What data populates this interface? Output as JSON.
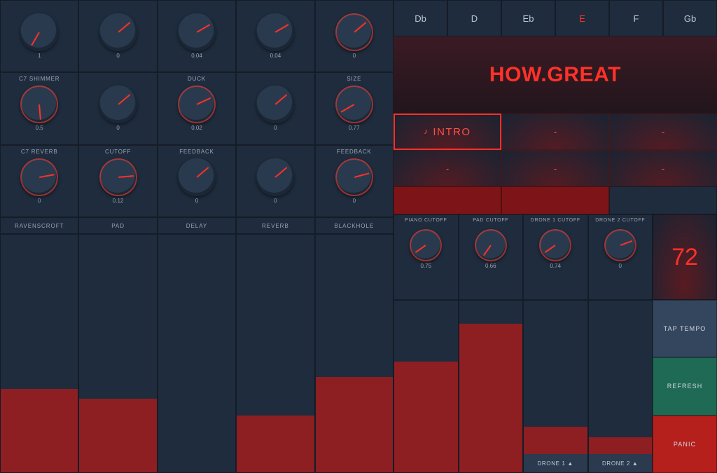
{
  "knobs": {
    "row0": [
      {
        "label": "",
        "value": "1",
        "angle": 30,
        "hot": 0
      },
      {
        "label": "",
        "value": "0",
        "angle": -130,
        "hot": 0
      },
      {
        "label": "",
        "value": "0.04",
        "angle": -120,
        "hot": 0
      },
      {
        "label": "",
        "value": "0.04",
        "angle": -120,
        "hot": 0
      },
      {
        "label": "",
        "value": "0",
        "angle": -130,
        "hot": 1
      }
    ],
    "row1": [
      {
        "label": "C7 SHIMMER",
        "value": "0.5",
        "angle": -5,
        "hot": 1
      },
      {
        "label": "",
        "value": "0",
        "angle": -130,
        "hot": 0
      },
      {
        "label": "DUCK",
        "value": "0.02",
        "angle": -115,
        "hot": 1
      },
      {
        "label": "",
        "value": "0",
        "angle": -130,
        "hot": 0
      },
      {
        "label": "SIZE",
        "value": "0.77",
        "angle": 60,
        "hot": 1
      }
    ],
    "row2": [
      {
        "label": "C7 REVERB",
        "value": "0",
        "angle": -100,
        "hot": 1
      },
      {
        "label": "CUTOFF",
        "value": "0.12",
        "angle": -95,
        "hot": 1
      },
      {
        "label": "FEEDBACK",
        "value": "0",
        "angle": -130,
        "hot": 0
      },
      {
        "label": "",
        "value": "0",
        "angle": -130,
        "hot": 0
      },
      {
        "label": "FEEDBACK",
        "value": "0",
        "angle": -105,
        "hot": 1
      }
    ]
  },
  "channels": [
    "RAVENSCROFT",
    "PAD",
    "DELAY",
    "REVERB",
    "BLACKHOLE"
  ],
  "faders_pct": [
    35,
    31,
    0,
    24,
    40
  ],
  "keys": [
    "Db",
    "D",
    "Eb",
    "E",
    "F",
    "Gb"
  ],
  "selected_key": "E",
  "song_title": "HOW.GREAT",
  "sections": [
    "INTRO",
    "-",
    "-",
    "-",
    "-",
    "-"
  ],
  "active_section": 0,
  "progress_filled": 2,
  "cutoffs": [
    {
      "label": "PIANO CUTOFF",
      "value": "0.75",
      "angle": 55,
      "hot": 1
    },
    {
      "label": "PAD CUTOFF",
      "value": "0.66",
      "angle": 35,
      "hot": 1
    },
    {
      "label": "DRONE 1 CUTOFF",
      "value": "0.74",
      "angle": 55,
      "hot": 1
    },
    {
      "label": "DRONE 2 CUTOFF",
      "value": "0",
      "angle": -110,
      "hot": 1
    }
  ],
  "bpm": "72",
  "bottom_faders": [
    {
      "cap": "",
      "pct": 54
    },
    {
      "cap": "",
      "pct": 76
    },
    {
      "cap": "DRONE 1 ▲",
      "pct": 16
    },
    {
      "cap": "DRONE 2 ▲",
      "pct": 10
    }
  ],
  "actions": {
    "tap": "TAP TEMPO",
    "refresh": "REFRESH",
    "panic": "PANIC"
  }
}
